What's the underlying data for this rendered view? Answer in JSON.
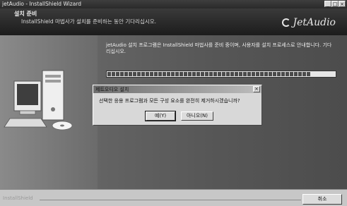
{
  "window": {
    "title": "jetAudio - InstallShield Wizard",
    "controls": [
      "minimize",
      "maximize",
      "close"
    ]
  },
  "header": {
    "title": "설치 준비",
    "subtitle": "InstallShield 마법사가 설치를 준비하는 동안 기다리십시오.",
    "logo_text": "JetAudio"
  },
  "main": {
    "message": "jetAudio 설치 프로그램은 InstallShield 마법사를 준비 중이며, 사용자를 설치 프로세스로 안내합니다. 기다리십시오.",
    "progress_segments": 48
  },
  "dialog": {
    "title": "제트오디오 설치",
    "question": "선택한 응용 프로그램과 모든 구성 요소를 완전히 제거하시겠습니까?",
    "yes_label": "예(Y)",
    "no_label": "아니오(N)"
  },
  "footer": {
    "brand": "InstallShield",
    "cancel_label": "취소"
  },
  "colors": {
    "header_bg": "#262626",
    "panel_bg": "#5a5a5a",
    "progress_fill": "#4a4a4a",
    "dialog_bg": "#d8d8d8"
  }
}
